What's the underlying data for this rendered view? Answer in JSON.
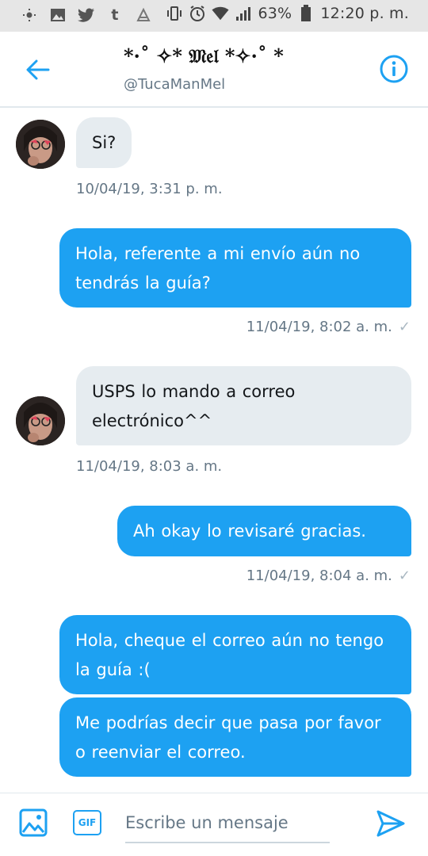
{
  "status_bar": {
    "left_icons": [
      "brightness-icon",
      "gallery-icon",
      "twitter-icon",
      "tumblr-icon",
      "sticker-icon"
    ],
    "right_icons": [
      "vibrate-icon",
      "alarm-icon",
      "wifi-icon",
      "signal-icon",
      "battery-icon"
    ],
    "battery": "63%",
    "time": "12:20 p. m.",
    "tumblr_glyph": "t"
  },
  "header": {
    "title": "*·˚ ✧* 𝔐𝔢𝔩 *✧·˚ *",
    "handle": "@TucaManMel",
    "back_icon": "arrow-left-icon",
    "info_icon": "info-icon",
    "accent": "#1da1f2"
  },
  "messages": [
    {
      "dir": "in",
      "text": "Si?",
      "timestamp": "10/04/19, 3:31 p. m."
    },
    {
      "dir": "out",
      "text": "Hola, referente a mi envío aún no tendrás la guía?",
      "timestamp": "11/04/19, 8:02 a. m.",
      "check": "✓"
    },
    {
      "dir": "in",
      "text": "USPS lo mando a correo electrónico^^",
      "timestamp": "11/04/19, 8:03 a. m."
    },
    {
      "dir": "out",
      "text": "Ah okay lo revisaré gracias.",
      "timestamp": "11/04/19, 8:04 a. m.",
      "check": "✓"
    },
    {
      "dir": "out",
      "text": "Hola, cheque el correo aún no tengo la guía :("
    },
    {
      "dir": "out",
      "text": "Me podrías decir que pasa por favor o reenviar el correo."
    }
  ],
  "composer": {
    "placeholder": "Escribe un mensaje",
    "value": "",
    "gif_label": "GIF",
    "photo_icon": "image-icon",
    "send_icon": "send-icon"
  },
  "colors": {
    "outgoing_bubble": "#1da1f2",
    "incoming_bubble": "#e6ecf0",
    "timestamp": "#657786"
  }
}
